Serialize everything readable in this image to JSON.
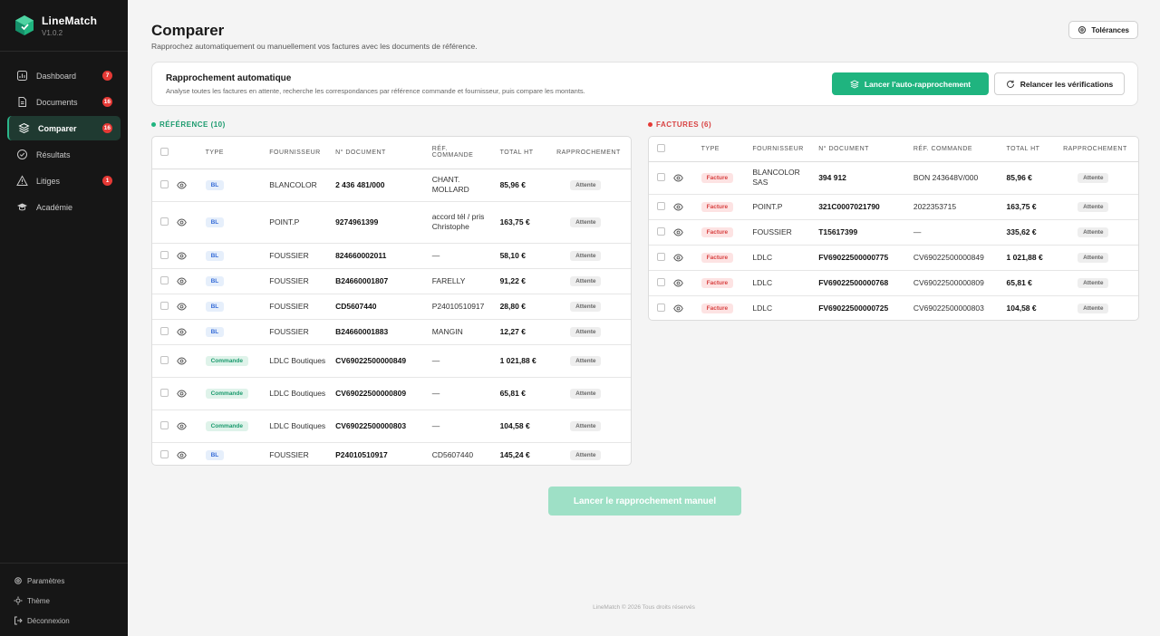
{
  "brand": {
    "name": "LineMatch",
    "version": "V1.0.2"
  },
  "nav": [
    {
      "label": "Dashboard",
      "badge": "7",
      "icon": "dashboard-icon"
    },
    {
      "label": "Documents",
      "badge": "16",
      "icon": "document-icon"
    },
    {
      "label": "Comparer",
      "badge": "16",
      "icon": "layers-icon",
      "active": true
    },
    {
      "label": "Résultats",
      "badge": "",
      "icon": "check-circle-icon"
    },
    {
      "label": "Litiges",
      "badge": "1",
      "icon": "warning-icon"
    },
    {
      "label": "Académie",
      "badge": "",
      "icon": "graduation-cap-icon"
    }
  ],
  "sidebar_bottom": {
    "settings": "Paramètres",
    "theme": "Thème",
    "logout": "Déconnexion"
  },
  "page": {
    "title": "Comparer",
    "subtitle": "Rapprochez automatiquement ou manuellement vos factures avec les documents de référence.",
    "tolerances_button": "Tolérances"
  },
  "auto": {
    "title": "Rapprochement automatique",
    "description": "Analyse toutes les factures en attente, recherche les correspondances par référence commande et fournisseur, puis compare les montants.",
    "run_button": "Lancer l'auto-rapprochement",
    "recheck_button": "Relancer les vérifications"
  },
  "reference": {
    "title": "RÉFÉRENCE (10)",
    "columns": {
      "type": "TYPE",
      "supplier": "FOURNISSEUR",
      "doc": "N° DOCUMENT",
      "ref1": "RÉF.",
      "ref2": "COMMANDE",
      "total": "TOTAL HT",
      "match": "RAPPROCHEMENT"
    },
    "rows": [
      {
        "type": "BL",
        "supplier": "BLANCOLOR",
        "doc": "2 436 481/000",
        "ref": "CHANT. MOLLARD",
        "total": "85,96 €",
        "status": "Attente"
      },
      {
        "type": "BL",
        "supplier": "POINT.P",
        "doc": "9274961399",
        "ref": "accord tél / pris Christophe",
        "total": "163,75 €",
        "status": "Attente"
      },
      {
        "type": "BL",
        "supplier": "FOUSSIER",
        "doc": "824660002011",
        "ref": "—",
        "total": "58,10 €",
        "status": "Attente"
      },
      {
        "type": "BL",
        "supplier": "FOUSSIER",
        "doc": "B24660001807",
        "ref": "FARELLY",
        "total": "91,22 €",
        "status": "Attente"
      },
      {
        "type": "BL",
        "supplier": "FOUSSIER",
        "doc": "CD5607440",
        "ref": "P24010510917",
        "total": "28,80 €",
        "status": "Attente"
      },
      {
        "type": "BL",
        "supplier": "FOUSSIER",
        "doc": "B24660001883",
        "ref": "MANGIN",
        "total": "12,27 €",
        "status": "Attente"
      },
      {
        "type": "Commande",
        "supplier": "LDLC Boutiques",
        "doc": "CV69022500000849",
        "ref": "—",
        "total": "1 021,88 €",
        "status": "Attente"
      },
      {
        "type": "Commande",
        "supplier": "LDLC Boutiques",
        "doc": "CV69022500000809",
        "ref": "—",
        "total": "65,81 €",
        "status": "Attente"
      },
      {
        "type": "Commande",
        "supplier": "LDLC Boutiques",
        "doc": "CV69022500000803",
        "ref": "—",
        "total": "104,58 €",
        "status": "Attente"
      },
      {
        "type": "BL",
        "supplier": "FOUSSIER",
        "doc": "P24010510917",
        "ref": "CD5607440",
        "total": "145,24 €",
        "status": "Attente"
      }
    ]
  },
  "invoices": {
    "title": "FACTURES (6)",
    "columns": {
      "type": "TYPE",
      "supplier": "FOURNISSEUR",
      "doc": "N° DOCUMENT",
      "ref": "RÉF. COMMANDE",
      "total": "TOTAL HT",
      "match": "RAPPROCHEMENT"
    },
    "rows": [
      {
        "type": "Facture",
        "supplier": "BLANCOLOR SAS",
        "doc": "394 912",
        "ref": "BON 243648V/000",
        "total": "85,96 €",
        "status": "Attente"
      },
      {
        "type": "Facture",
        "supplier": "POINT.P",
        "doc": "321C0007021790",
        "ref": "2022353715",
        "total": "163,75 €",
        "status": "Attente"
      },
      {
        "type": "Facture",
        "supplier": "FOUSSIER",
        "doc": "T15617399",
        "ref": "—",
        "total": "335,62 €",
        "status": "Attente"
      },
      {
        "type": "Facture",
        "supplier": "LDLC",
        "doc": "FV69022500000775",
        "ref": "CV69022500000849",
        "total": "1 021,88 €",
        "status": "Attente"
      },
      {
        "type": "Facture",
        "supplier": "LDLC",
        "doc": "FV69022500000768",
        "ref": "CV69022500000809",
        "total": "65,81 €",
        "status": "Attente"
      },
      {
        "type": "Facture",
        "supplier": "LDLC",
        "doc": "FV69022500000725",
        "ref": "CV69022500000803",
        "total": "104,58 €",
        "status": "Attente"
      }
    ]
  },
  "manual_button": "Lancer le rapprochement manuel",
  "footer": "LineMatch © 2026 Tous droits réservés",
  "colors": {
    "accent": "#1fb47f",
    "sidebar": "#161616",
    "danger": "#e53935",
    "bl": "#3a6fd8"
  }
}
